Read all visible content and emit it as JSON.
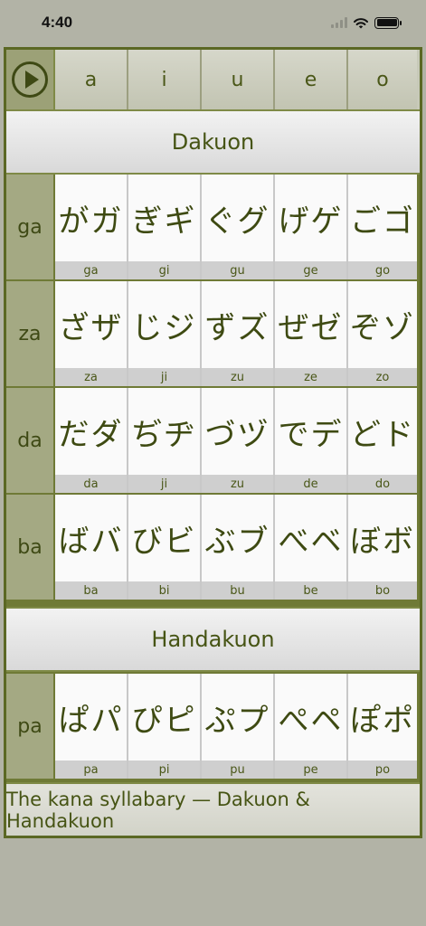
{
  "status": {
    "time": "4:40"
  },
  "header": {
    "vowels": [
      "a",
      "i",
      "u",
      "e",
      "o"
    ]
  },
  "sections": {
    "dakuon": "Dakuon",
    "handakuon": "Handakuon"
  },
  "rows": [
    {
      "label": "ga",
      "cells": [
        {
          "kana": "がガ",
          "romaji": "ga"
        },
        {
          "kana": "ぎギ",
          "romaji": "gi"
        },
        {
          "kana": "ぐグ",
          "romaji": "gu"
        },
        {
          "kana": "げゲ",
          "romaji": "ge"
        },
        {
          "kana": "ごゴ",
          "romaji": "go"
        }
      ]
    },
    {
      "label": "za",
      "cells": [
        {
          "kana": "ざザ",
          "romaji": "za"
        },
        {
          "kana": "じジ",
          "romaji": "ji"
        },
        {
          "kana": "ずズ",
          "romaji": "zu"
        },
        {
          "kana": "ぜゼ",
          "romaji": "ze"
        },
        {
          "kana": "ぞゾ",
          "romaji": "zo"
        }
      ]
    },
    {
      "label": "da",
      "cells": [
        {
          "kana": "だダ",
          "romaji": "da"
        },
        {
          "kana": "ぢヂ",
          "romaji": "ji"
        },
        {
          "kana": "づヅ",
          "romaji": "zu"
        },
        {
          "kana": "でデ",
          "romaji": "de"
        },
        {
          "kana": "どド",
          "romaji": "do"
        }
      ]
    },
    {
      "label": "ba",
      "cells": [
        {
          "kana": "ばバ",
          "romaji": "ba"
        },
        {
          "kana": "びビ",
          "romaji": "bi"
        },
        {
          "kana": "ぶブ",
          "romaji": "bu"
        },
        {
          "kana": "べベ",
          "romaji": "be"
        },
        {
          "kana": "ぼボ",
          "romaji": "bo"
        }
      ]
    },
    {
      "label": "pa",
      "cells": [
        {
          "kana": "ぱパ",
          "romaji": "pa"
        },
        {
          "kana": "ぴピ",
          "romaji": "pi"
        },
        {
          "kana": "ぷプ",
          "romaji": "pu"
        },
        {
          "kana": "ぺペ",
          "romaji": "pe"
        },
        {
          "kana": "ぽポ",
          "romaji": "po"
        }
      ]
    }
  ],
  "footer": {
    "caption": "The kana syllabary — Dakuon & Handakuon"
  },
  "icons": {
    "play": "play-icon",
    "wifi": "wifi-icon",
    "signal": "signal-icon",
    "battery": "battery-icon"
  },
  "colors": {
    "accent": "#3e4914",
    "board": "#6f7a36",
    "background": "#b2b3a6"
  }
}
